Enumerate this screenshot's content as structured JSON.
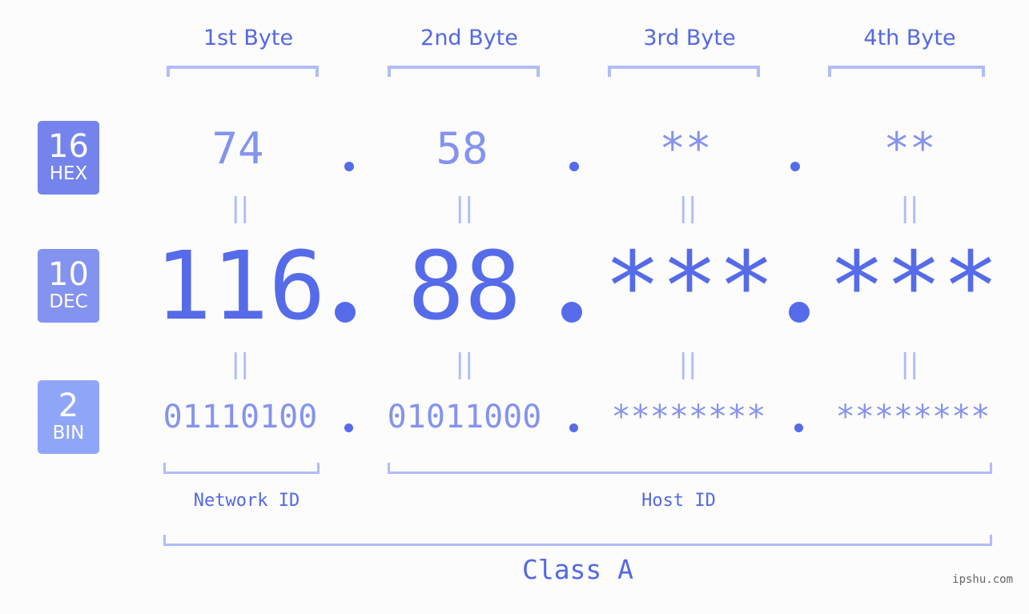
{
  "byte_headers": [
    "1st Byte",
    "2nd Byte",
    "3rd Byte",
    "4th Byte"
  ],
  "bases": [
    {
      "number": "16",
      "label": "HEX",
      "color": "#7584ec"
    },
    {
      "number": "10",
      "label": "DEC",
      "color": "#8492f0"
    },
    {
      "number": "2",
      "label": "BIN",
      "color": "#8fa6f8"
    }
  ],
  "hex": [
    "74",
    "58",
    "**",
    "**"
  ],
  "dec": [
    "116",
    "88",
    "***",
    "***"
  ],
  "bin": [
    "01110100",
    "01011000",
    "********",
    "********"
  ],
  "separator": ".",
  "equals_symbol": "||",
  "groups": {
    "network": "Network ID",
    "host": "Host ID"
  },
  "class_label": "Class A",
  "watermark": "ipshu.com",
  "colors": {
    "accent": "#566be9",
    "light_accent": "#8593ee",
    "bracket": "#b1bcf7"
  }
}
